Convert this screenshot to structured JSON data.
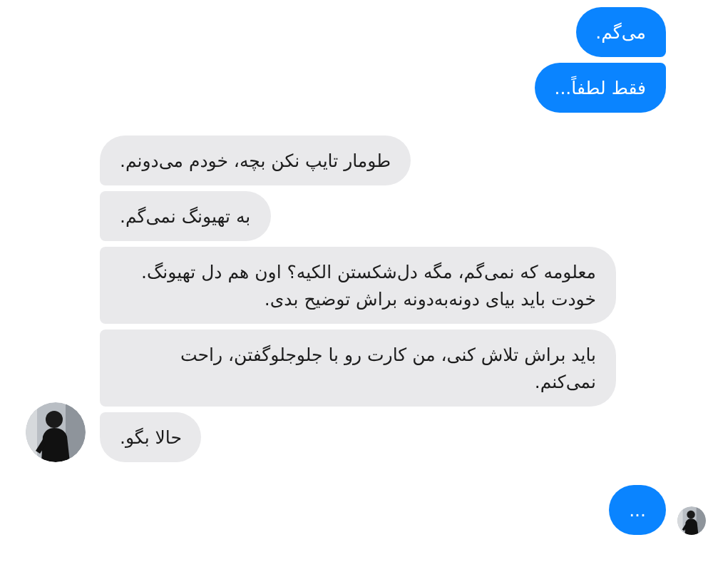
{
  "groups": [
    {
      "kind": "outgoing",
      "messages": [
        {
          "text": "می‌گم."
        },
        {
          "text": "فقط لطفاً..."
        }
      ]
    },
    {
      "kind": "incoming",
      "avatar": {
        "kind": "picture"
      },
      "messages": [
        {
          "text": "طومار تایپ نکن بچه، خودم می‌دونم."
        },
        {
          "text": "به تهیونگ نمی‌گم."
        },
        {
          "text": "معلومه که نمی‌گم، مگه دل‌شکستن الکیه؟ اون هم دل تهیونگ. خودت باید بیای دونه‌به‌دونه براش توضیح بدی."
        },
        {
          "text": "باید براش تلاش کنی، من کارت رو با جلوجلوگفتن، راحت نمی‌کنم."
        },
        {
          "text": "حالا بگو."
        }
      ]
    },
    {
      "kind": "outgoing",
      "avatar": {
        "kind": "picture"
      },
      "messages": [
        {
          "text": "..."
        }
      ]
    }
  ]
}
